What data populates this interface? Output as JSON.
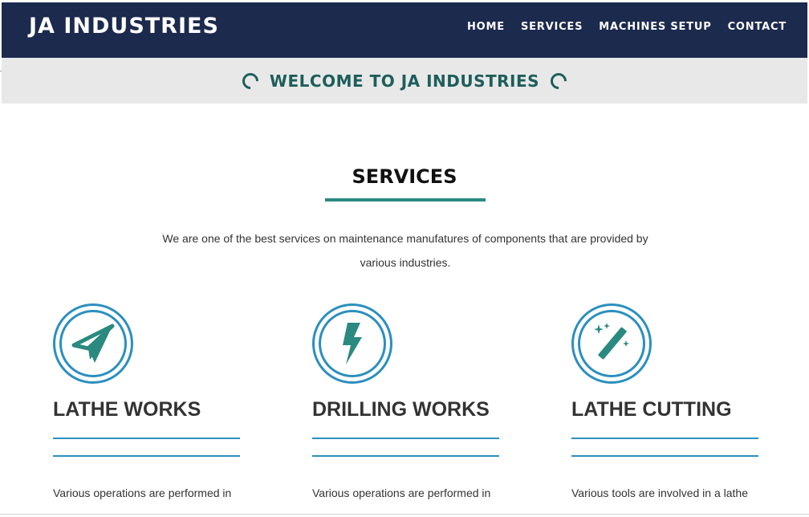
{
  "header": {
    "brand": "JA INDUSTRIES",
    "nav": [
      "HOME",
      "SERVICES",
      "MACHINES SETUP",
      "CONTACT"
    ],
    "bg_color": "#1c2a4e"
  },
  "welcome": {
    "text": "WELCOME TO JA INDUSTRIES",
    "left_icon": "loading-ring-icon",
    "right_icon": "loading-ring-icon",
    "color": "#1d5e5a"
  },
  "services": {
    "title": "SERVICES",
    "intro": "We are one of the best services on maintenance manufatures of components that are provided by various industries.",
    "accent_color": "#2a8a80",
    "cards": [
      {
        "icon": "paper-plane-icon",
        "title": "LATHE WORKS",
        "desc": "Various operations are performed in"
      },
      {
        "icon": "lightning-bolt-icon",
        "title": "DRILLING WORKS",
        "desc": "Various operations are performed in"
      },
      {
        "icon": "magic-wand-icon",
        "title": "LATHE CUTTING",
        "desc": "Various tools are involved in a lathe"
      }
    ]
  }
}
